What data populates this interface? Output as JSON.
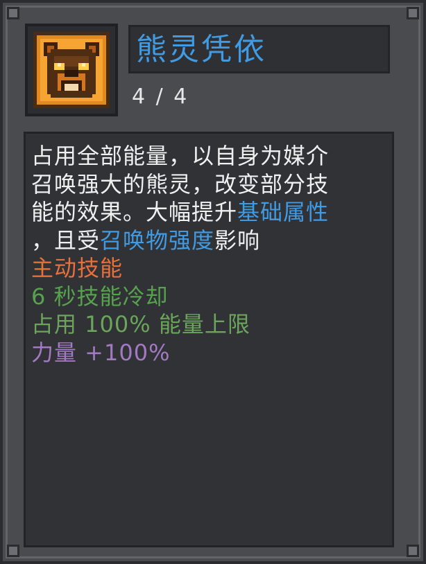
{
  "skill": {
    "name": "熊灵凭依",
    "level": "4 / 4",
    "icon": "bear-spirit-icon"
  },
  "description": {
    "line1": "占用全部能量，以自身为媒介",
    "line2": "召唤强大的熊灵，改变部分技",
    "line3_text": "能的效果。大幅提升",
    "line3_link": "基础属性",
    "line4_prefix": "，且受",
    "line4_link": "召唤物强度",
    "line4_suffix": "影响"
  },
  "stats": {
    "type_label": "主动技能",
    "cooldown": "6 秒技能冷却",
    "energy": "占用 100% 能量上限",
    "strength": "力量 +100%"
  },
  "colors": {
    "title": "#3f9be4",
    "keyword": "#3f9be4",
    "active_skill": "#e8703a",
    "cooldown": "#57a24e",
    "strength": "#a27ac2"
  }
}
